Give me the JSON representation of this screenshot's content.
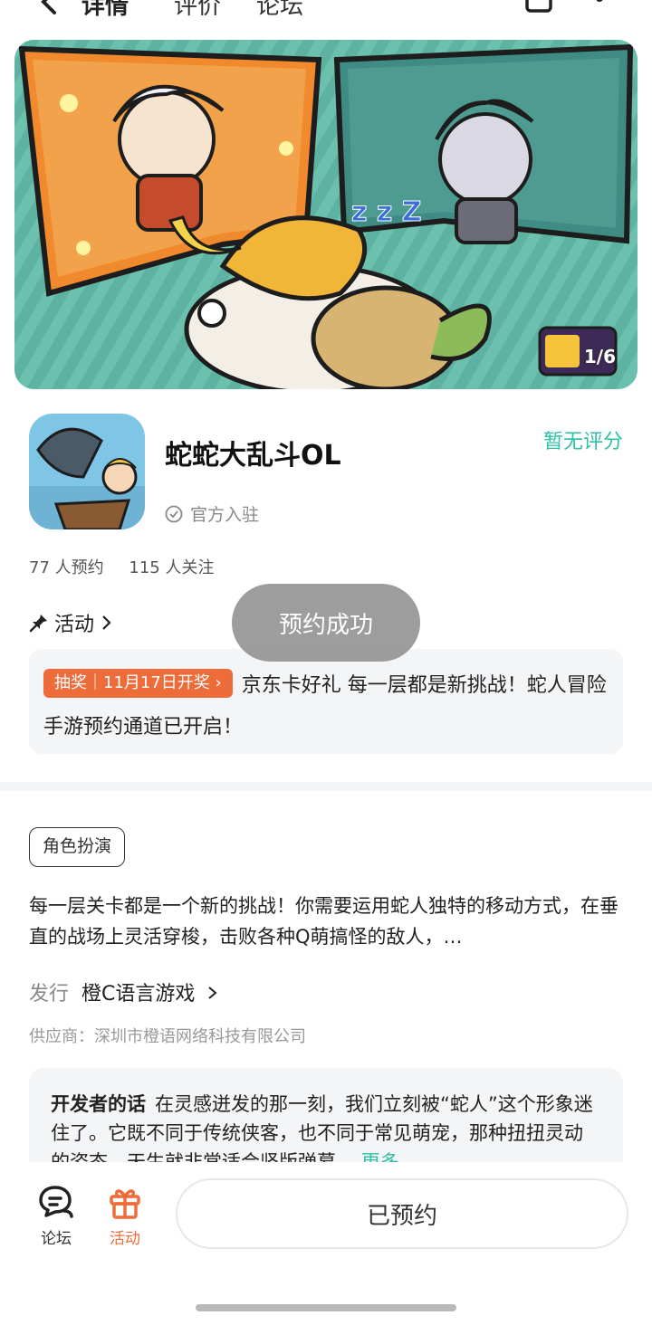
{
  "header": {
    "tabs": [
      {
        "label": "详情",
        "active": true
      },
      {
        "label": "评价",
        "active": false
      },
      {
        "label": "论坛",
        "active": false
      }
    ]
  },
  "banner": {
    "counter": "1/6"
  },
  "app": {
    "name": "蛇蛇大乱斗OL",
    "official_label": "官方入驻",
    "rating": "暂无评分",
    "reservations": "77 人预约",
    "followers": "115 人关注"
  },
  "activity": {
    "title": "活动",
    "badge": "抽奖｜11月17日开奖",
    "text": "京东卡好礼 每一层都是新挑战！蛇人冒险手游预约通道已开启！"
  },
  "toast": {
    "text": "预约成功"
  },
  "detail": {
    "tag": "角色扮演",
    "description": "每一层关卡都是一个新的挑战！你需要运用蛇人独特的移动方式，在垂直的战场上灵活穿梭，击败各种Q萌搞怪的敌人，…",
    "publisher_label": "发行",
    "publisher_name": "橙C语言游戏",
    "supplier": "供应商：深圳市橙语网络科技有限公司"
  },
  "developer_note": {
    "label": "开发者的话",
    "text": "在灵感迸发的那一刻，我们立刻被“蛇人”这个形象迷住了。它既不同于传统侠客，也不同于常见萌宠，那种扭扭灵动的姿态，天生就非常适合竖版弹幕…",
    "more": "更多"
  },
  "bottom_bar": {
    "forum_label": "论坛",
    "event_label": "活动",
    "reserved_label": "已预约"
  },
  "colors": {
    "accent": "#2ebfa4",
    "orange": "#ee6b3a"
  }
}
